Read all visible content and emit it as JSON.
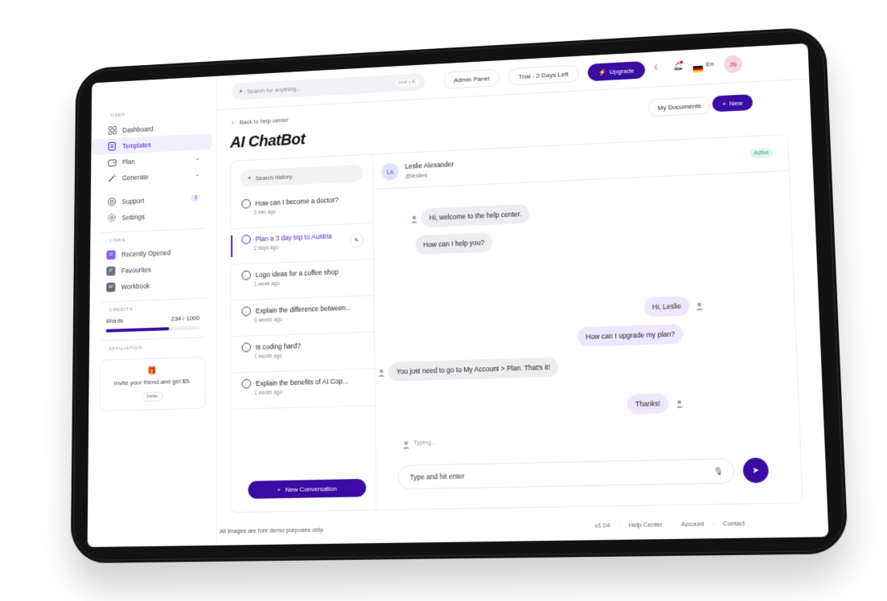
{
  "sidebar": {
    "section_user": "USER",
    "items": [
      {
        "label": "Dashboard",
        "icon": "grid-icon"
      },
      {
        "label": "Templates",
        "icon": "document-icon"
      },
      {
        "label": "Plan",
        "icon": "wallet-icon"
      },
      {
        "label": "Generate",
        "icon": "wand-icon"
      },
      {
        "label": "Support",
        "icon": "lifebuoy-icon",
        "badge": "3"
      },
      {
        "label": "Settings",
        "icon": "gear-icon"
      }
    ],
    "section_links": "LINKS",
    "links": [
      {
        "letter": "R",
        "label": "Recently Opened",
        "color": "#8b5cf6"
      },
      {
        "letter": "F",
        "label": "Favourites",
        "color": "#6b7280"
      },
      {
        "letter": "W",
        "label": "Workbook",
        "color": "#5b6f7a"
      }
    ],
    "section_credits": "CREDITS",
    "credits": {
      "label": "Words",
      "value": "234 / 1000",
      "fraction": 0.68
    },
    "section_affiliation": "AFFILIATION",
    "affiliation": {
      "text": "Invite your friend and get $5.",
      "button": "Invite"
    }
  },
  "topbar": {
    "search_placeholder": "Search for anything...",
    "shortcut": "cmd + E",
    "admin": "Admin Panel",
    "trial": "Trial - 2 Days Left",
    "upgrade": "Upgrade",
    "lang": "En",
    "avatar": "JS"
  },
  "header": {
    "back": "Back to help center",
    "title": "AI ChatBot",
    "my_documents": "My Documents",
    "new": "New"
  },
  "history": {
    "search": "Search history",
    "items": [
      {
        "q": "How can I become a doctor?",
        "t": "3 min ago"
      },
      {
        "q": "Plan a 3 day trip to Austria",
        "t": "2 days ago"
      },
      {
        "q": "Logo ideas for a coffee shop",
        "t": "1 week ago"
      },
      {
        "q": "Explain the difference between...",
        "t": "3 weeks ago"
      },
      {
        "q": "Is coding hard?",
        "t": "1 month ago"
      },
      {
        "q": "Explain the benefits of AI Cop...",
        "t": "1 month ago"
      }
    ],
    "new_conversation": "New Conversation"
  },
  "chat": {
    "contact_initials": "LA",
    "contact_name": "Leslie Alexander",
    "contact_handle": "@lesliee",
    "status": "Active",
    "messages": [
      {
        "text": "Hi, welcome to the help center.",
        "dir": "in"
      },
      {
        "text": "How can I help you?",
        "dir": "in"
      },
      {
        "text": "Hi, Leslie",
        "dir": "out"
      },
      {
        "text": "How can I upgrade my plan?",
        "dir": "out"
      },
      {
        "text": "You just need to go to My Account > Plan. That's it!",
        "dir": "in"
      },
      {
        "text": "Thanks!",
        "dir": "out"
      }
    ],
    "typing": "Typing...",
    "composer_placeholder": "Type and hit enter"
  },
  "footer": {
    "disclaimer": "All images are fore demo purposes only.",
    "version": "v1.04",
    "links": [
      "Help Center",
      "Account",
      "Contact"
    ]
  }
}
